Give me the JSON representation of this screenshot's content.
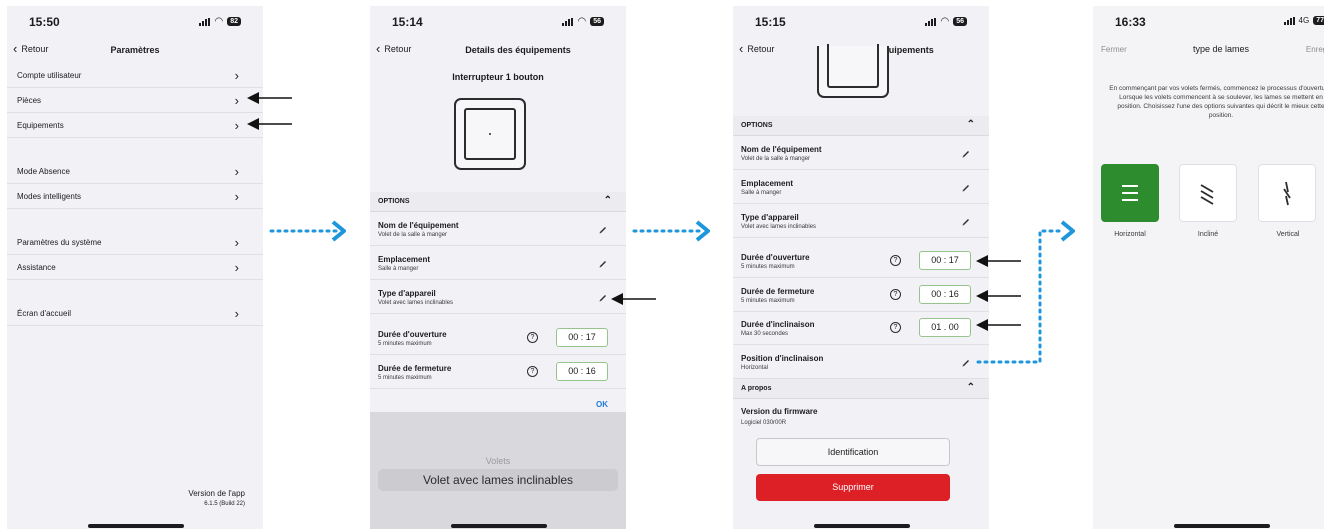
{
  "screens": {
    "settings": {
      "time": "15:50",
      "battery": "82",
      "back_label": "Retour",
      "title": "Paramètres",
      "items": [
        {
          "label": "Compte utilisateur"
        },
        {
          "label": "Pièces"
        },
        {
          "label": "Equipements"
        },
        {
          "label": "Mode Absence"
        },
        {
          "label": "Modes intelligents"
        },
        {
          "label": "Paramètres du système"
        },
        {
          "label": "Assistance"
        },
        {
          "label": "Écran d'accueil"
        }
      ],
      "version_label": "Version de l'app",
      "version_value": "6.1.5 (Build 22)"
    },
    "details_picker": {
      "time": "15:14",
      "battery": "56",
      "back_label": "Retour",
      "title": "Details des équipements",
      "device_name": "Interrupteur 1 bouton",
      "options_header": "OPTIONS",
      "fields": [
        {
          "title": "Nom de l'équipement",
          "value": "Volet de la salle à manger"
        },
        {
          "title": "Emplacement",
          "value": "Salle à manger"
        },
        {
          "title": "Type d'appareil",
          "value": "Volet avec lames inclinables"
        }
      ],
      "durations": [
        {
          "title": "Durée d'ouverture",
          "hint": "5 minutes maximum",
          "value": "00 : 17"
        },
        {
          "title": "Durée de fermeture",
          "hint": "5 minutes maximum",
          "value": "00 : 16"
        }
      ],
      "ok_label": "OK",
      "picker_options": [
        "Volets",
        "Volet avec lames inclinables"
      ]
    },
    "details_full": {
      "time": "15:15",
      "battery": "56",
      "back_label": "Retour",
      "title": "Details des équipements",
      "options_header": "OPTIONS",
      "fields": [
        {
          "title": "Nom de l'équipement",
          "value": "Volet de la salle à manger"
        },
        {
          "title": "Emplacement",
          "value": "Salle à manger"
        },
        {
          "title": "Type d'appareil",
          "value": "Volet avec lames inclinables"
        }
      ],
      "durations": [
        {
          "title": "Durée d'ouverture",
          "hint": "5 minutes maximum",
          "value": "00 : 17"
        },
        {
          "title": "Durée de fermeture",
          "hint": "5 minutes maximum",
          "value": "00 : 16"
        },
        {
          "title": "Durée d'inclinaison",
          "hint": "Max 30 secondes",
          "value": "01 . 00"
        }
      ],
      "tilt_position": {
        "title": "Position d'inclinaison",
        "value": "Horizontal"
      },
      "about_header": "A propos",
      "firmware_label": "Version du firmware",
      "firmware_value": "Logiciel 030r00R",
      "identify_label": "Identification",
      "delete_label": "Supprimer"
    },
    "slat_type": {
      "time": "16:33",
      "network": "4G",
      "battery": "77",
      "close_label": "Fermer",
      "title": "type de lames",
      "save_label": "Enregistrer",
      "description": "En commençant par vos volets fermés, commencez le processus d'ouverture. Lorsque les volets commencent à se soulever, les lames se mettent en position. Choisissez l'une des options suivantes qui décrit le mieux cette position.",
      "options": [
        {
          "label": "Horizontal",
          "selected": true
        },
        {
          "label": "Incliné",
          "selected": false
        },
        {
          "label": "Vertical",
          "selected": false
        }
      ]
    }
  },
  "colors": {
    "accent_blue": "#1e96dc",
    "selected_green": "#2d8c2d",
    "delete_red": "#dd1f26",
    "ok_blue": "#1f7bd6"
  }
}
